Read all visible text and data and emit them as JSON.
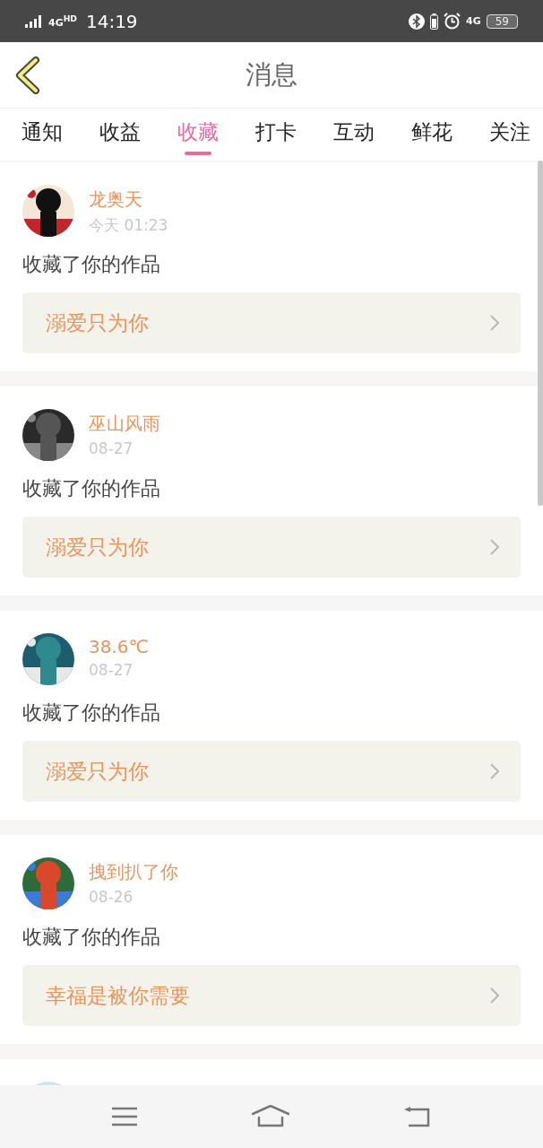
{
  "status_bar": {
    "network": "4G$^{HD}$",
    "time": "14:19",
    "network_right": "4G",
    "battery": "59"
  },
  "header": {
    "title": "消息"
  },
  "tabs": [
    {
      "label": "通知",
      "selected": false
    },
    {
      "label": "收益",
      "selected": false
    },
    {
      "label": "收藏",
      "selected": true
    },
    {
      "label": "打卡",
      "selected": false
    },
    {
      "label": "互动",
      "selected": false
    },
    {
      "label": "鲜花",
      "selected": false
    },
    {
      "label": "关注",
      "selected": false
    }
  ],
  "messages": [
    {
      "user": "龙奥天",
      "time": "今天 01:23",
      "text": "收藏了你的作品",
      "work": "溺爱只为你"
    },
    {
      "user": "巫山风雨",
      "time": "08-27",
      "text": "收藏了你的作品",
      "work": "溺爱只为你"
    },
    {
      "user": "38.6℃",
      "time": "08-27",
      "text": "收藏了你的作品",
      "work": "溺爱只为你"
    },
    {
      "user": "拽到扒了你",
      "time": "08-26",
      "text": "收藏了你的作品",
      "work": "幸福是被你需要"
    }
  ]
}
